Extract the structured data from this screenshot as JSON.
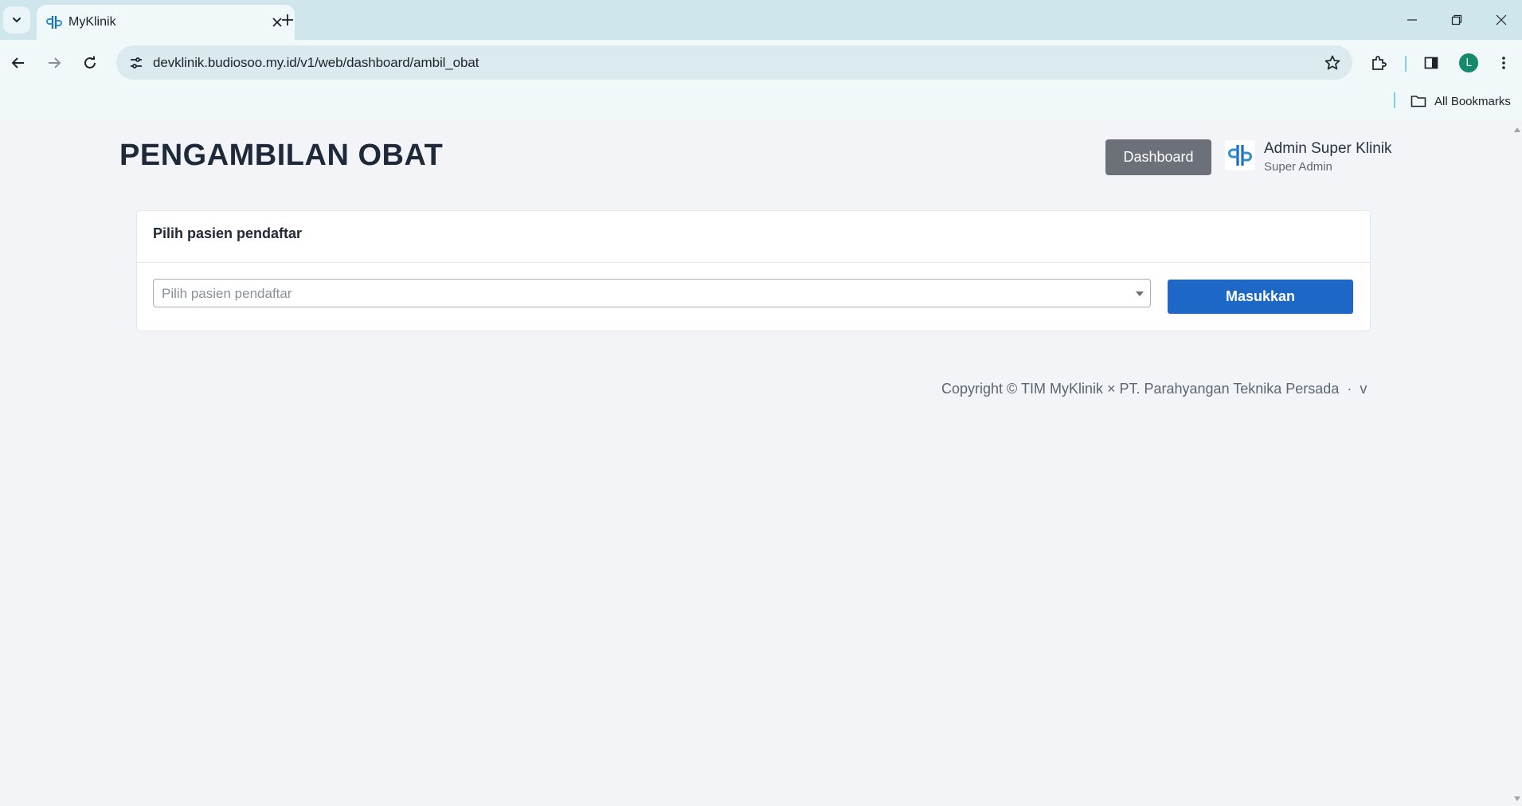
{
  "browser": {
    "tab_title": "MyKlinik",
    "url": "devklinik.budiosoo.my.id/v1/web/dashboard/ambil_obat",
    "bookmarks_label": "All Bookmarks",
    "profile_initial": "L"
  },
  "header": {
    "page_title": "PENGAMBILAN OBAT",
    "dashboard_label": "Dashboard",
    "user_name": "Admin Super Klinik",
    "user_role": "Super Admin"
  },
  "card": {
    "title": "Pilih pasien pendaftar",
    "select_placeholder": "Pilih pasien pendaftar",
    "submit_label": "Masukkan"
  },
  "footer": {
    "copyright": "Copyright © TIM MyKlinik × PT. Parahyangan Teknika Persada",
    "separator": "·",
    "version": "v"
  },
  "colors": {
    "primary": "#1d67c6",
    "secondary": "#6b7079",
    "background": "#f3f4f7"
  }
}
